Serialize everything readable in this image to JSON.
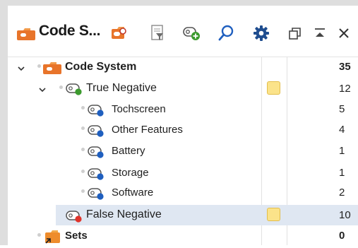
{
  "header": {
    "title": "Code S...",
    "icons": [
      "code-system-icon",
      "activate-codes-icon",
      "filter-icon",
      "new-code-icon",
      "search-icon",
      "settings-icon",
      "undock-icon",
      "collapse-icon",
      "close-icon"
    ]
  },
  "tree": {
    "root": {
      "label": "Code System",
      "count": "35",
      "expanded": true
    },
    "true_negative": {
      "label": "True Negative",
      "count": "12",
      "has_memo": true,
      "color": "#3c9a2e",
      "expanded": true
    },
    "children": [
      {
        "label": "Tochscreen",
        "count": "5",
        "color": "#1f5fbf"
      },
      {
        "label": "Other Features",
        "count": "4",
        "color": "#1f5fbf"
      },
      {
        "label": "Battery",
        "count": "1",
        "color": "#1f5fbf"
      },
      {
        "label": "Storage",
        "count": "1",
        "color": "#1f5fbf"
      },
      {
        "label": "Software",
        "count": "2",
        "color": "#1f5fbf"
      }
    ],
    "false_negative": {
      "label": "False Negative",
      "count": "10",
      "has_memo": true,
      "color": "#e0332a",
      "selected": true
    },
    "sets": {
      "label": "Sets",
      "count": "0"
    }
  },
  "colors": {
    "orange": "#e8742a",
    "selection": "#dfe7f2",
    "memo": "#fbe38a",
    "accent_blue": "#1f5fbf"
  }
}
